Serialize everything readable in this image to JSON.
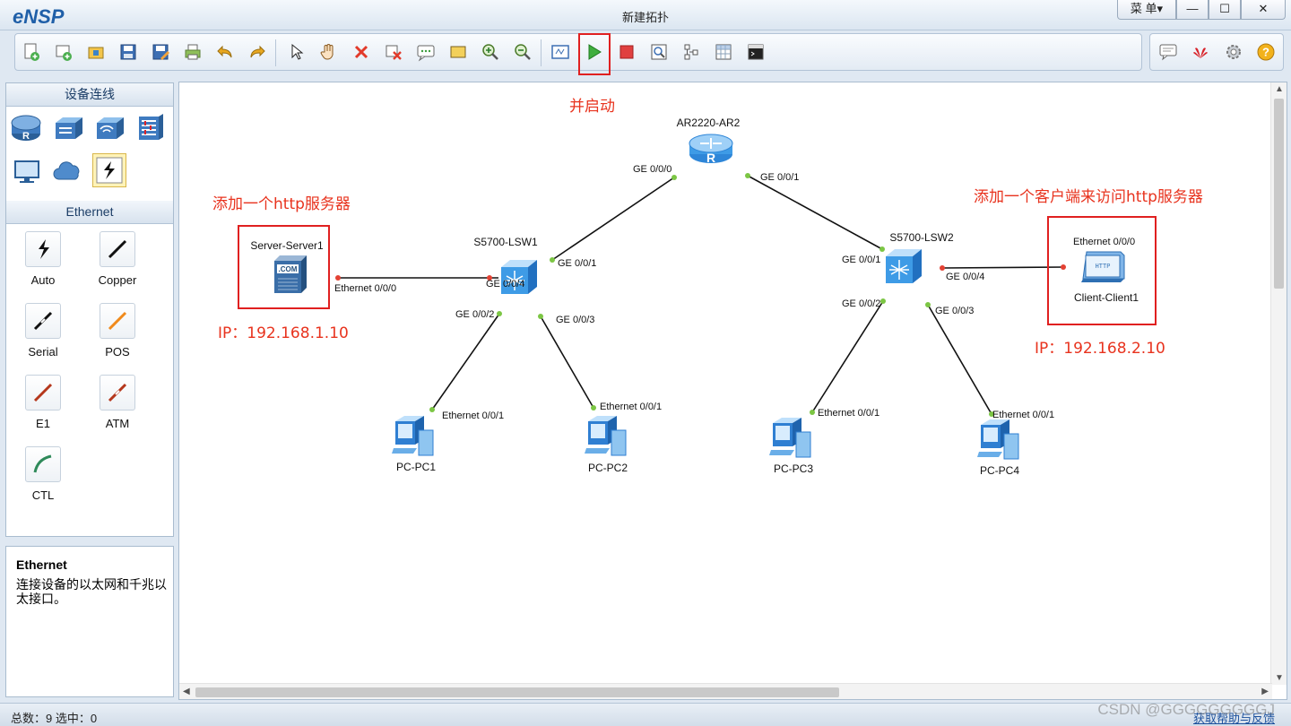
{
  "window": {
    "app_name": "eNSP",
    "title": "新建拓扑",
    "menu_label": "菜 单▾",
    "minimize": "—",
    "maximize": "☐",
    "close": "✕"
  },
  "toolbar": {
    "buttons": [
      "new-topology-icon",
      "new-example-icon",
      "open-icon",
      "save-icon",
      "save-as-icon",
      "print-icon",
      "undo-icon",
      "redo-icon",
      "select-icon",
      "pan-hand-icon",
      "delete-icon",
      "delete-link-icon",
      "text-note-icon",
      "rectangle-icon",
      "zoom-in-icon",
      "zoom-out-icon",
      "fit-view-icon",
      "start-device-icon",
      "stop-device-icon",
      "capture-icon",
      "topology-icon",
      "grid-icon",
      "cli-icon"
    ],
    "right_buttons": [
      "chat-icon",
      "huawei-icon",
      "settings-icon",
      "help-icon"
    ]
  },
  "palette": {
    "devices_header": "设备连线",
    "devices": [
      "router-icon",
      "switch-icon",
      "wireless-icon",
      "firewall-icon",
      "pc-icon",
      "cloud-icon",
      "connection-icon"
    ],
    "links_header": "Ethernet",
    "links": [
      {
        "label": "Auto",
        "color": "#111111"
      },
      {
        "label": "Copper",
        "color": "#111111"
      },
      {
        "label": "Serial",
        "color": "#111111"
      },
      {
        "label": "POS",
        "color": "#f08a1c"
      },
      {
        "label": "E1",
        "color": "#b5371c"
      },
      {
        "label": "ATM",
        "color": "#b5371c"
      },
      {
        "label": "CTL",
        "color": "#2f8a5a"
      }
    ]
  },
  "info": {
    "title": "Ethernet",
    "description": "连接设备的以太网和千兆以太接口。"
  },
  "topology": {
    "nodes": {
      "router": "AR2220-AR2",
      "lsw1": "S5700-LSW1",
      "lsw2": "S5700-LSW2",
      "server": "Server-Server1",
      "client": "Client-Client1",
      "pc1": "PC-PC1",
      "pc2": "PC-PC2",
      "pc3": "PC-PC3",
      "pc4": "PC-PC4"
    },
    "ports": {
      "ar_ge000": "GE 0/0/0",
      "ar_ge001": "GE 0/0/1",
      "lsw1_ge001": "GE 0/0/1",
      "lsw1_ge004": "GE 0/0/4",
      "lsw1_ge002": "GE 0/0/2",
      "lsw1_ge003": "GE 0/0/3",
      "lsw2_ge001": "GE 0/0/1",
      "lsw2_ge004": "GE 0/0/4",
      "lsw2_ge002": "GE 0/0/2",
      "lsw2_ge003": "GE 0/0/3",
      "server_eth": "Ethernet 0/0/0",
      "client_eth": "Ethernet 0/0/0",
      "pc1_eth": "Ethernet 0/0/1",
      "pc2_eth": "Ethernet 0/0/1",
      "pc3_eth": "Ethernet 0/0/1",
      "pc4_eth": "Ethernet 0/0/1",
      "server_badge": ".COM",
      "client_badge": "HTTP"
    },
    "annotations": {
      "start": "并启动",
      "add_server": "添加一个http服务器",
      "add_client": "添加一个客户端来访问http服务器",
      "server_ip": "IP：192.168.1.10",
      "client_ip": "IP：192.168.2.10"
    }
  },
  "statusbar": {
    "counts": "总数：9  选中：0",
    "help": "获取帮助与反馈",
    "watermark": "CSDN @GGGGGGGGGJ"
  }
}
